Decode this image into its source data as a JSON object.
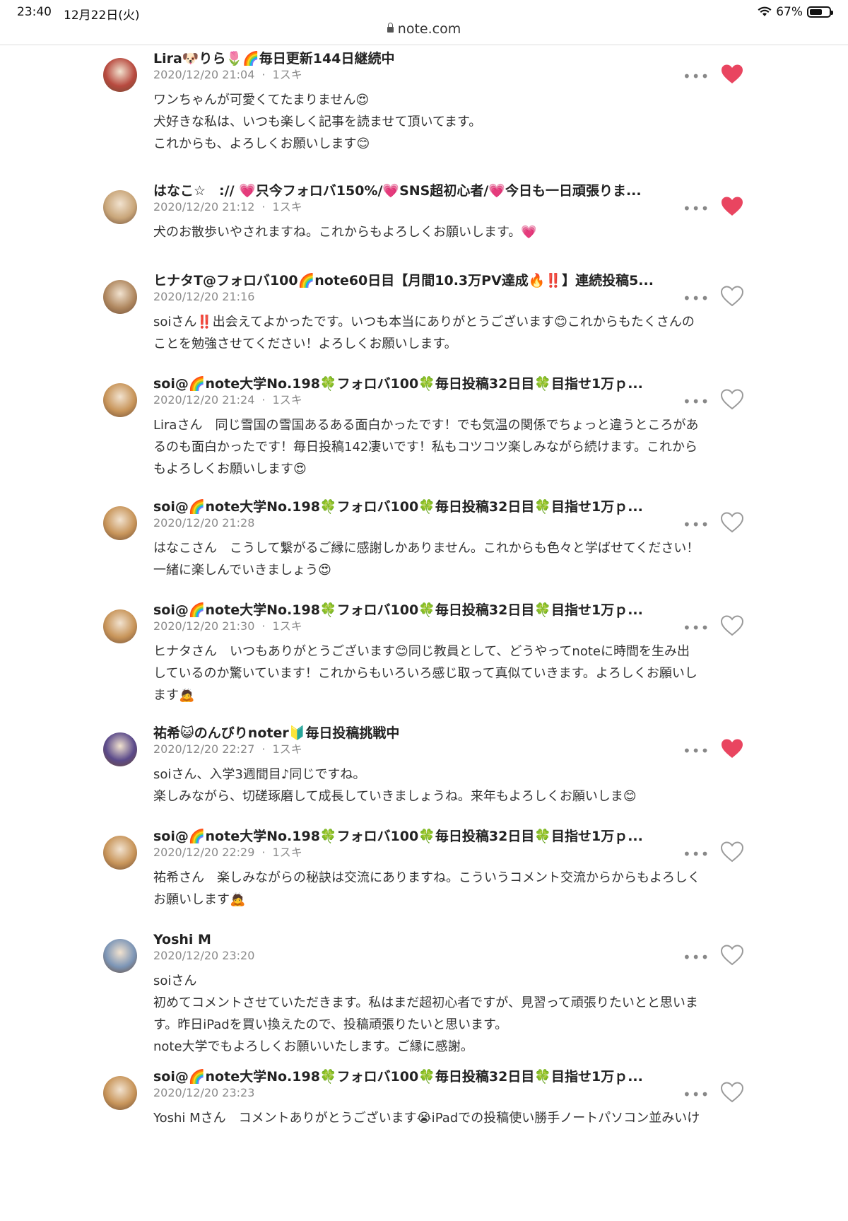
{
  "status_bar": {
    "time": "23:40",
    "date": "12月22日(火)",
    "battery": "67%",
    "battery_level": 0.67
  },
  "browser": {
    "url": "note.com"
  },
  "colors": {
    "liked_heart": "#e94560",
    "unliked_heart": "#9a9a9a"
  },
  "comments": [
    {
      "name": "Lira🐶りら🌷🌈毎日更新144日継続中",
      "date": "2020/12/20 21:04",
      "likes": "1スキ",
      "liked": true,
      "lines": [
        "ワンちゃんが可愛くてたまりません😍",
        "犬好きな私は、いつも楽しく記事を読ませて頂いてます。",
        "これからも、よろしくお願いします😊"
      ]
    },
    {
      "name": "はなこ☆　:// 💗只今フォロバ150%/💗SNS超初心者/💗今日も一日頑張りま...",
      "date": "2020/12/20 21:12",
      "likes": "1スキ",
      "liked": true,
      "lines": [
        "犬のお散歩いやされますね。これからもよろしくお願いします。💗"
      ]
    },
    {
      "name": "ヒナタT@フォロバ100🌈note60日目【月間10.3万PV達成🔥‼️】連続投稿5...",
      "date": "2020/12/20 21:16",
      "likes": "",
      "liked": false,
      "lines": [
        "soiさん‼️出会えてよかったです。いつも本当にありがとうございます😊これからもたくさんの",
        "ことを勉強させてください！よろしくお願いします。"
      ]
    },
    {
      "name": "soi@🌈note大学No.198🍀フォロバ100🍀毎日投稿32日目🍀目指せ1万ｐ...",
      "date": "2020/12/20 21:24",
      "likes": "1スキ",
      "liked": false,
      "lines": [
        "Liraさん　同じ雪国の雪国あるある面白かったです！でも気温の関係でちょっと違うところがあ",
        "るのも面白かったです！毎日投稿142凄いです！私もコツコツ楽しみながら続けます。これから",
        "もよろしくお願いします😍"
      ]
    },
    {
      "name": "soi@🌈note大学No.198🍀フォロバ100🍀毎日投稿32日目🍀目指せ1万ｐ...",
      "date": "2020/12/20 21:28",
      "likes": "",
      "liked": false,
      "lines": [
        "はなこさん　こうして繋がるご縁に感謝しかありません。これからも色々と学ばせてください！",
        "一緒に楽しんでいきましょう😍"
      ]
    },
    {
      "name": "soi@🌈note大学No.198🍀フォロバ100🍀毎日投稿32日目🍀目指せ1万ｐ...",
      "date": "2020/12/20 21:30",
      "likes": "1スキ",
      "liked": false,
      "lines": [
        "ヒナタさん　いつもありがとうございます😊同じ教員として、どうやってnoteに時間を生み出",
        "しているのか驚いています！これからもいろいろ感じ取って真似ていきます。よろしくお願いし",
        "ます🙇"
      ]
    },
    {
      "name": "祐希😺のんびりnoter🔰毎日投稿挑戦中",
      "date": "2020/12/20 22:27",
      "likes": "1スキ",
      "liked": true,
      "lines": [
        "soiさん、入学3週間目♪同じですね。",
        "楽しみながら、切磋琢磨して成長していきましょうね。来年もよろしくお願いしま😊"
      ]
    },
    {
      "name": "soi@🌈note大学No.198🍀フォロバ100🍀毎日投稿32日目🍀目指せ1万ｐ...",
      "date": "2020/12/20 22:29",
      "likes": "1スキ",
      "liked": false,
      "lines": [
        "祐希さん　楽しみながらの秘訣は交流にありますね。こういうコメント交流からからもよろしく",
        "お願いします🙇"
      ]
    },
    {
      "name": "Yoshi M",
      "date": "2020/12/20 23:20",
      "likes": "",
      "liked": false,
      "lines": [
        "soiさん",
        "初めてコメントさせていただきます。私はまだ超初心者ですが、見習って頑張りたいとと思いま",
        "す。昨日iPadを買い換えたので、投稿頑張りたいと思います。",
        "note大学でもよろしくお願いいたします。ご縁に感謝。"
      ]
    },
    {
      "name": "soi@🌈note大学No.198🍀フォロバ100🍀毎日投稿32日目🍀目指せ1万ｐ...",
      "date": "2020/12/20 23:23",
      "likes": "",
      "liked": false,
      "lines": [
        "Yoshi Mさん　コメントありがとうございます😭iPadでの投稿使い勝手ノートパソコン並みいけ"
      ]
    }
  ]
}
